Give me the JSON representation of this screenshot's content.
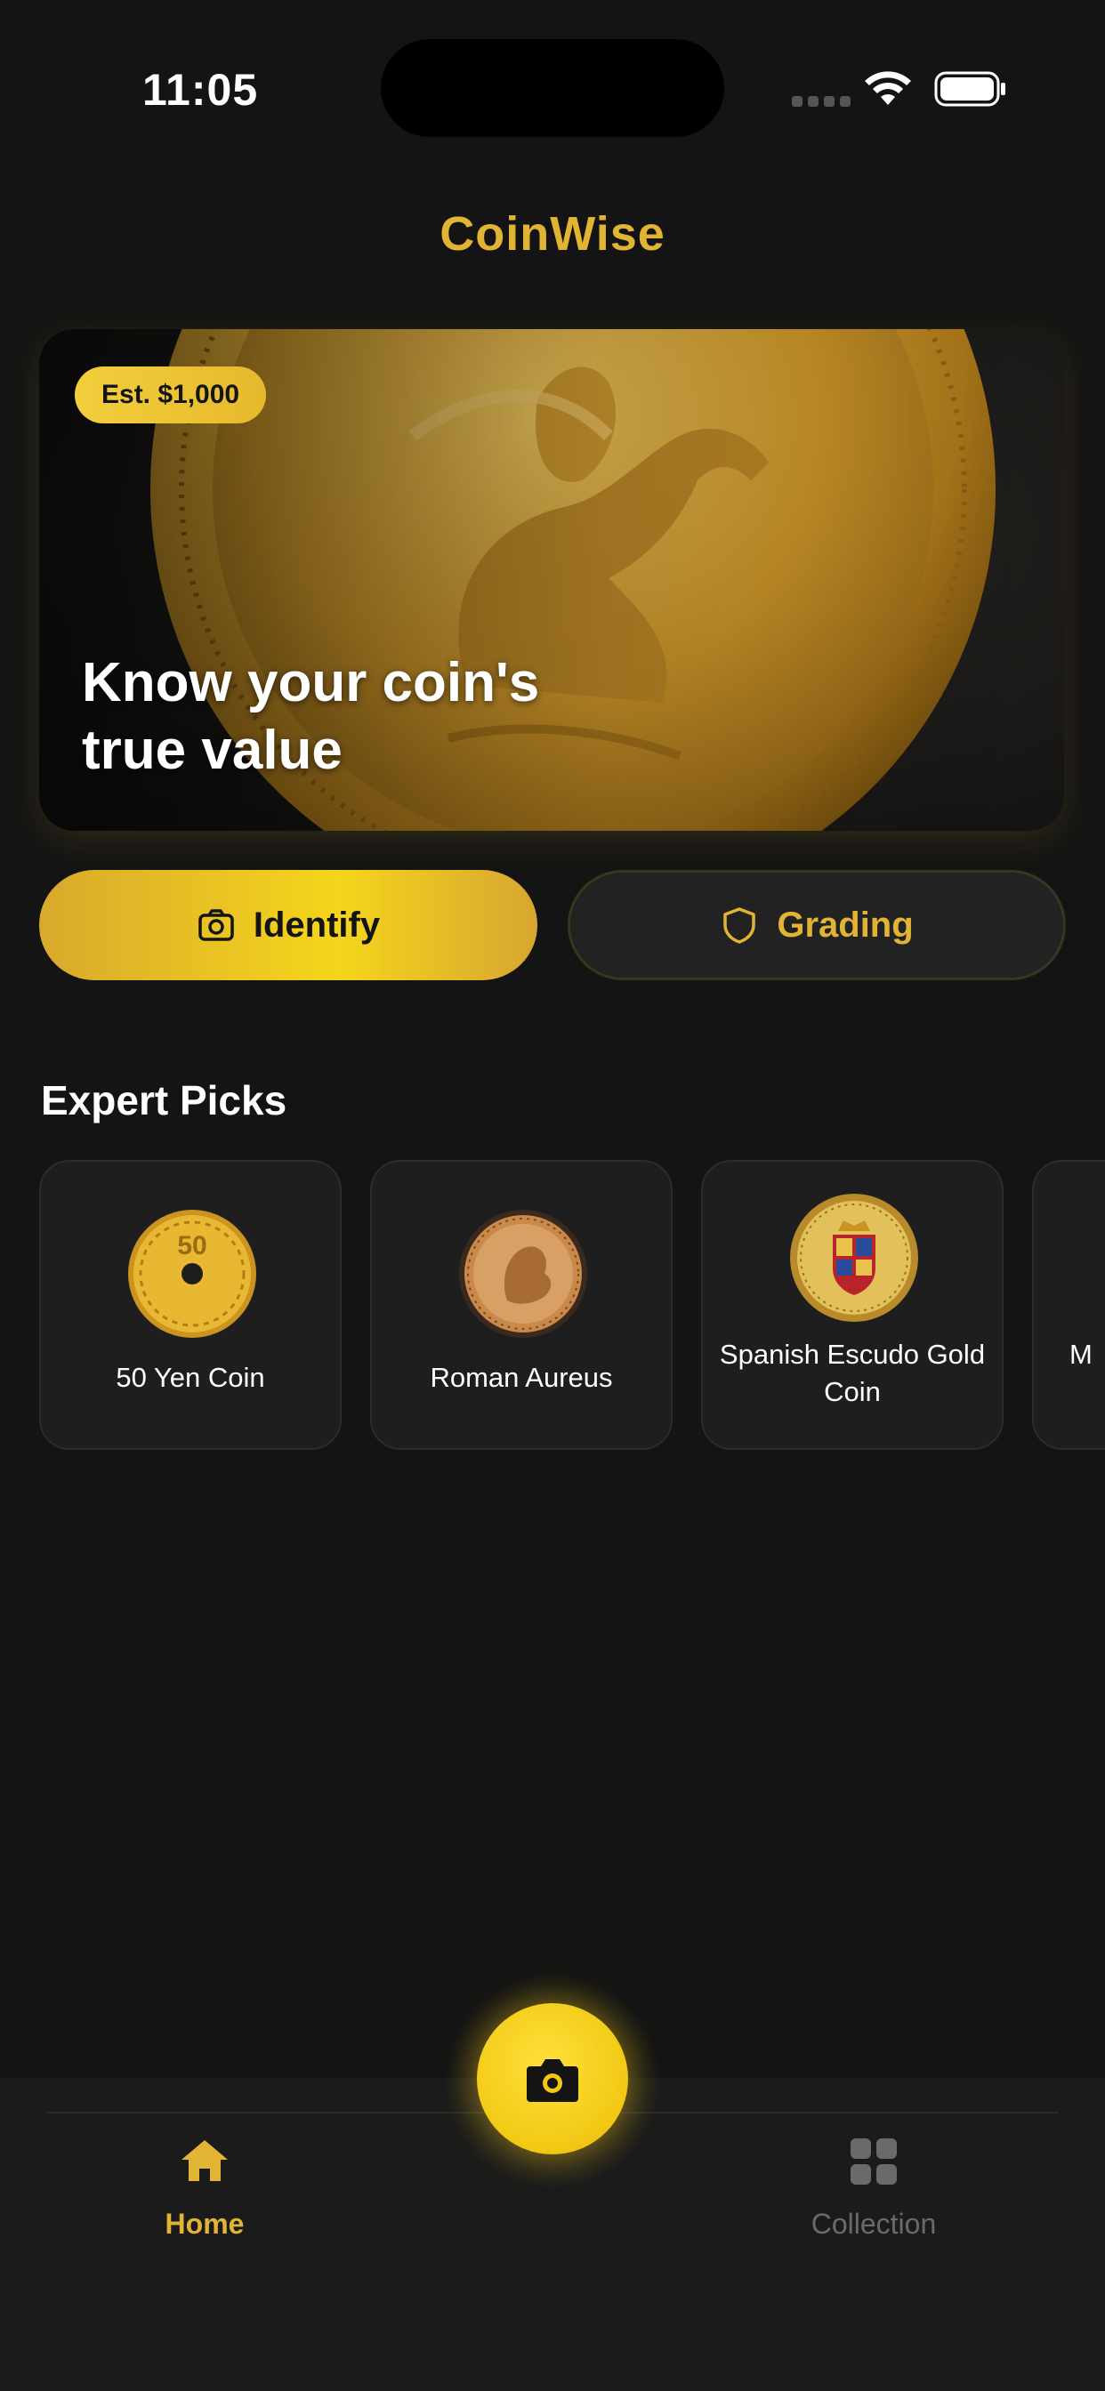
{
  "status_bar": {
    "time": "11:05"
  },
  "header": {
    "title": "CoinWise"
  },
  "hero": {
    "badge": "Est. $1,000",
    "headline": "Know your coin's true value"
  },
  "actions": {
    "identify_label": "Identify",
    "grading_label": "Grading"
  },
  "expert_picks": {
    "title": "Expert Picks",
    "items": [
      {
        "label": "50 Yen Coin"
      },
      {
        "label": "Roman Aureus"
      },
      {
        "label": "Spanish Escudo Gold Coin"
      },
      {
        "label": "M"
      }
    ]
  },
  "nav": {
    "home_label": "Home",
    "collection_label": "Collection"
  },
  "colors": {
    "accent": "#e2b433",
    "background": "#141414",
    "card": "#1e1e1e",
    "fab": "#f5d01e"
  },
  "icons": {
    "identify": "camera-icon",
    "grading": "shield-icon",
    "fab": "camera-icon",
    "home": "home-icon",
    "collection": "grid-icon"
  }
}
